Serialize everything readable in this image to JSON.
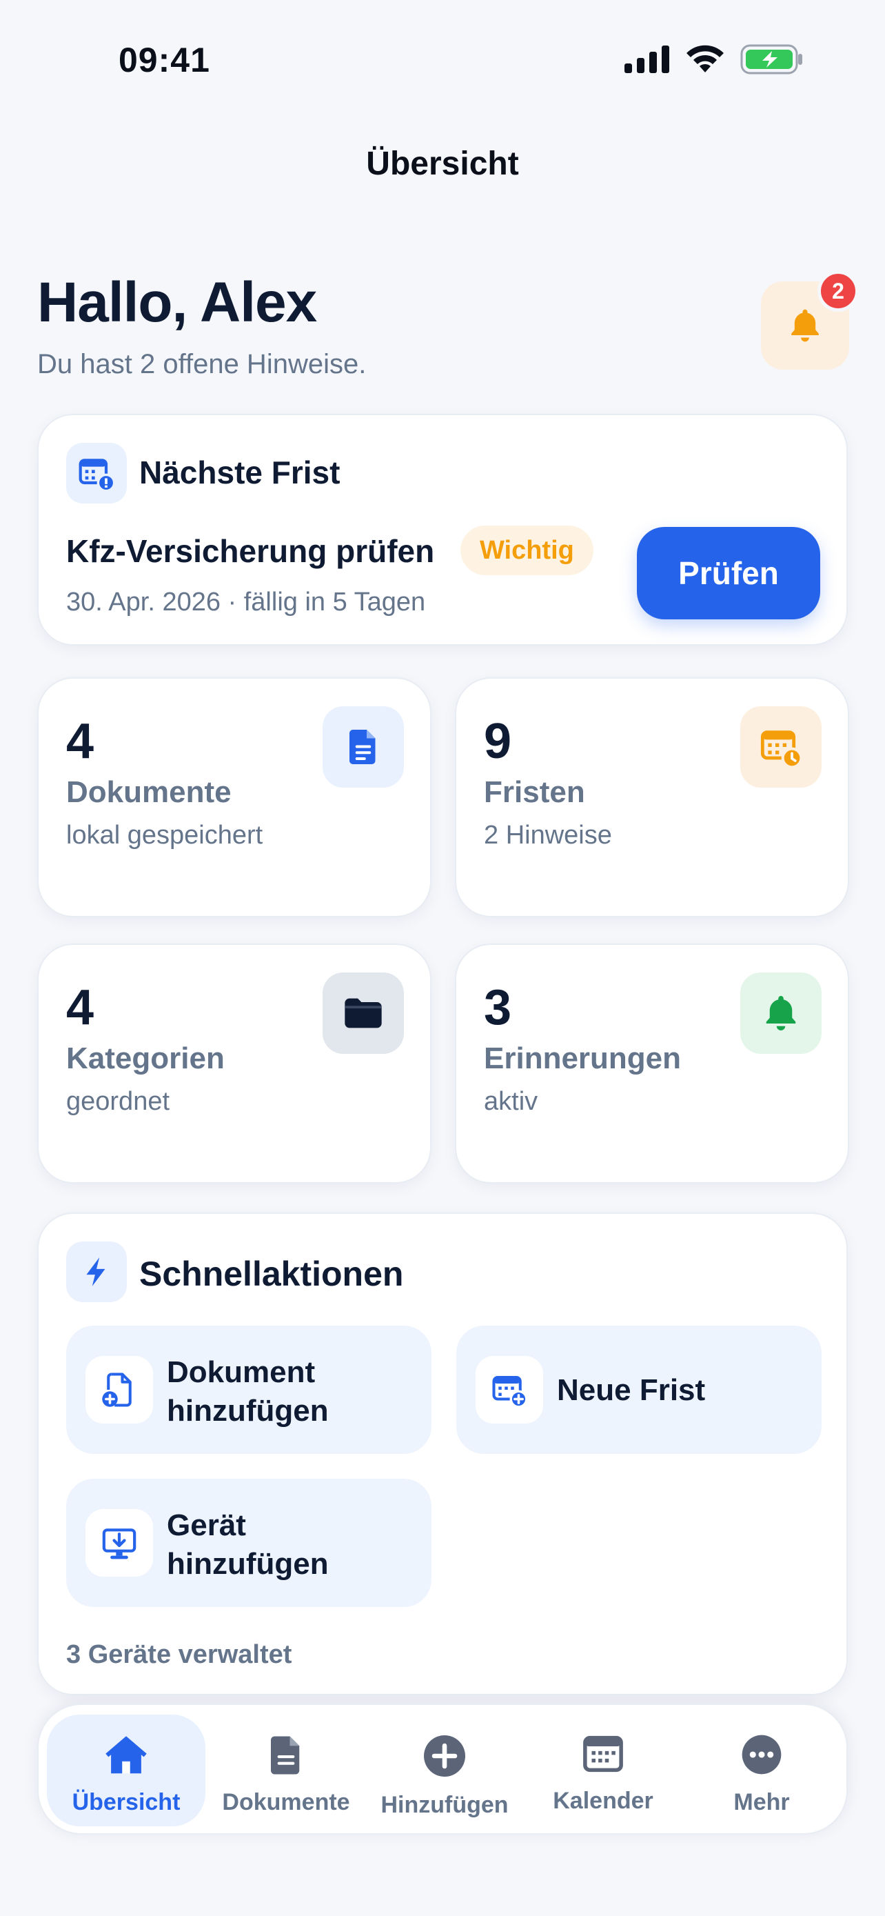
{
  "status_bar": {
    "time": "09:41"
  },
  "nav": {
    "title": "Übersicht"
  },
  "greeting": {
    "title": "Hallo, Alex",
    "subtitle": "Du hast 2 offene Hinweise.",
    "badge_count": "2"
  },
  "next_deadline": {
    "heading": "Nächste Frist",
    "title": "Kfz-Versicherung prüfen",
    "tag": "Wichtig",
    "date_line": "30. Apr. 2026 · fällig in 5 Tagen",
    "button_label": "Prüfen"
  },
  "stats": [
    {
      "value": "4",
      "label": "Dokumente",
      "sub": "lokal gespeichert",
      "icon": "document-icon",
      "color": "#2563EB"
    },
    {
      "value": "9",
      "label": "Fristen",
      "sub": "2 Hinweise",
      "icon": "calendar-clock-icon",
      "color": "#F59E0B"
    },
    {
      "value": "4",
      "label": "Kategorien",
      "sub": "geordnet",
      "icon": "folder-icon",
      "color": "#0F1B33"
    },
    {
      "value": "3",
      "label": "Erinnerungen",
      "sub": "aktiv",
      "icon": "bell-icon",
      "color": "#16A34A"
    }
  ],
  "quick_actions": {
    "heading": "Schnellaktionen",
    "items": [
      {
        "label_line1": "Dokument",
        "label_line2": "hinzufügen",
        "icon": "document-add-icon"
      },
      {
        "label": "Neue Frist",
        "icon": "calendar-add-icon"
      },
      {
        "label_line1": "Gerät",
        "label_line2": "hinzufügen",
        "icon": "device-add-icon"
      }
    ],
    "footer": "3 Geräte verwaltet"
  },
  "tab_bar": {
    "items": [
      {
        "label": "Übersicht",
        "icon": "home-icon",
        "active": true
      },
      {
        "label": "Dokumente",
        "icon": "document-icon",
        "active": false
      },
      {
        "label": "Hinzufügen",
        "icon": "plus-circle-icon",
        "active": false
      },
      {
        "label": "Kalender",
        "icon": "calendar-icon",
        "active": false
      },
      {
        "label": "Mehr",
        "icon": "more-icon",
        "active": false
      }
    ]
  },
  "colors": {
    "accent": "#2563EB",
    "warning": "#F59E0B",
    "danger": "#EF4444",
    "success": "#16A34A",
    "muted": "#64748B"
  }
}
